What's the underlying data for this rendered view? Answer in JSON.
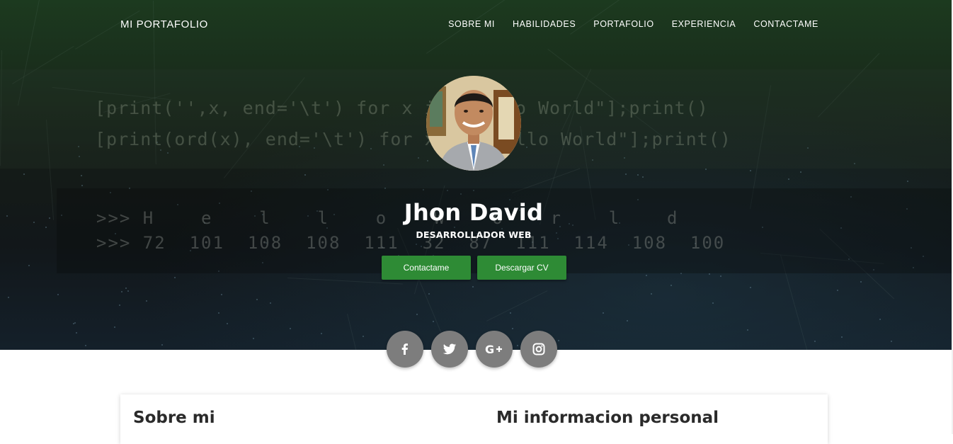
{
  "navbar": {
    "brand": "MI PORTAFOLIO",
    "links": [
      "SOBRE MI",
      "HABILIDADES",
      "PORTAFOLIO",
      "EXPERIENCIA",
      "CONTACTAME"
    ]
  },
  "hero": {
    "background_code": {
      "line1": "[print('',x, end='\\t') for x in \"Hello World\"];print()",
      "line2": "[print(ord(x), end='\\t') for x in \"Hello World\"];print()",
      "output1": ">>> H    e    l    l    o    W    o    r    l    d",
      "output2": ">>> 72  101  108  108  111  32  87  111  114  108  100"
    },
    "name": "Jhon David",
    "role": "DESARROLLADOR WEB",
    "buttons": {
      "contact": "Contactame",
      "download_cv": "Descargar CV"
    },
    "button_color": "#2e8b35"
  },
  "social": [
    {
      "icon": "facebook-icon"
    },
    {
      "icon": "twitter-icon"
    },
    {
      "icon": "google-plus-icon"
    },
    {
      "icon": "instagram-icon"
    }
  ],
  "sections": {
    "about_title": "Sobre mi",
    "personal_info_title": "Mi informacion personal"
  }
}
